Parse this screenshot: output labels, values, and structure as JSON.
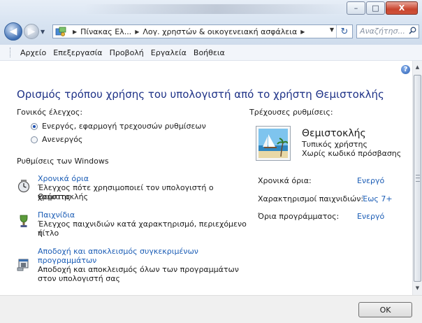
{
  "window": {
    "controls": {
      "minimize": "–",
      "maximize": "□",
      "close": "X"
    }
  },
  "nav": {
    "back_icon": "back-arrow-icon",
    "forward_icon": "forward-arrow-icon"
  },
  "address": {
    "crumbs": [
      "Πίνακας Ελ...",
      "Λογ. χρηστών & οικογενειακή ασφάλεια"
    ],
    "sep": "▶",
    "dropdown": "▼",
    "refresh": "↻"
  },
  "search": {
    "placeholder": "Αναζήτησ...",
    "icon": "⚲"
  },
  "menu": [
    "Αρχείο",
    "Επεξεργασία",
    "Προβολή",
    "Εργαλεία",
    "Βοήθεια"
  ],
  "help": "?",
  "page": {
    "title": "Ορισμός τρόπου χρήσης του υπολογιστή από το χρήστη Θεμιστοκλής",
    "parental_label": "Γονικός έλεγχος:",
    "options": [
      {
        "label": "Ενεργός, εφαρμογή τρεχουσών ρυθμίσεων",
        "selected": true
      },
      {
        "label": "Ανενεργός",
        "selected": false
      }
    ],
    "windows_settings_label": "Ρυθμίσεις των Windows",
    "tasks": [
      {
        "link": "Χρονικά όρια",
        "desc": [
          "Έλεγχος πότε χρησιμοποιεί τον υπολογιστή ο χρήστης",
          "Θεμιστοκλής"
        ],
        "icon": "clock-icon"
      },
      {
        "link": "Παιχνίδια",
        "desc": [
          "Έλεγχος παιχνιδιών κατά χαρακτηρισμό, περιεχόμενο ή",
          "τίτλο"
        ],
        "icon": "games-icon"
      },
      {
        "link": [
          "Αποδοχή και αποκλεισμός συγκεκριμένων",
          "προγραμμάτων"
        ],
        "desc": [
          "Αποδοχή και αποκλεισμός όλων των προγραμμάτων",
          "στον υπολογιστή σας"
        ],
        "icon": "programs-icon"
      }
    ]
  },
  "current": {
    "label": "Τρέχουσες ρυθμίσεις:",
    "user_name": "Θεμιστοκλής",
    "user_type": "Τυπικός χρήστης",
    "user_password": "Χωρίς κωδικό πρόσβασης",
    "rows": [
      {
        "label": "Χρονικά όρια:",
        "value": "Ενεργό"
      },
      {
        "label": "Χαρακτηρισμοί παιχνιδιών:",
        "value": "Έως 7+"
      },
      {
        "label": "Όρια προγράμματος:",
        "value": "Ενεργό"
      }
    ]
  },
  "scroll": {
    "up": "▲",
    "down": "▼"
  },
  "ok_label": "OK",
  "colors": {
    "link": "#1a5cb5",
    "title": "#1e3287"
  }
}
